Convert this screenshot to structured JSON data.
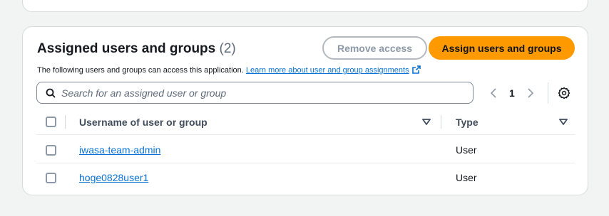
{
  "panel": {
    "title": "Assigned users and groups",
    "count": "(2)",
    "remove_label": "Remove access",
    "assign_label": "Assign users and groups",
    "description": "The following users and groups can access this application.",
    "learn_more": "Learn more about user and group assignments"
  },
  "search": {
    "placeholder": "Search for an assigned user or group"
  },
  "pagination": {
    "current_page": "1"
  },
  "table": {
    "columns": [
      "Username of user or group",
      "Type"
    ],
    "rows": [
      {
        "username": "iwasa-team-admin",
        "type": "User"
      },
      {
        "username": "hoge0828user1",
        "type": "User"
      }
    ]
  },
  "colors": {
    "primary": "#ff9900",
    "link": "#0972d3"
  },
  "icons": [
    "search-icon",
    "chevron-left-icon",
    "chevron-right-icon",
    "gear-icon",
    "external-link-icon",
    "sort-icon"
  ]
}
